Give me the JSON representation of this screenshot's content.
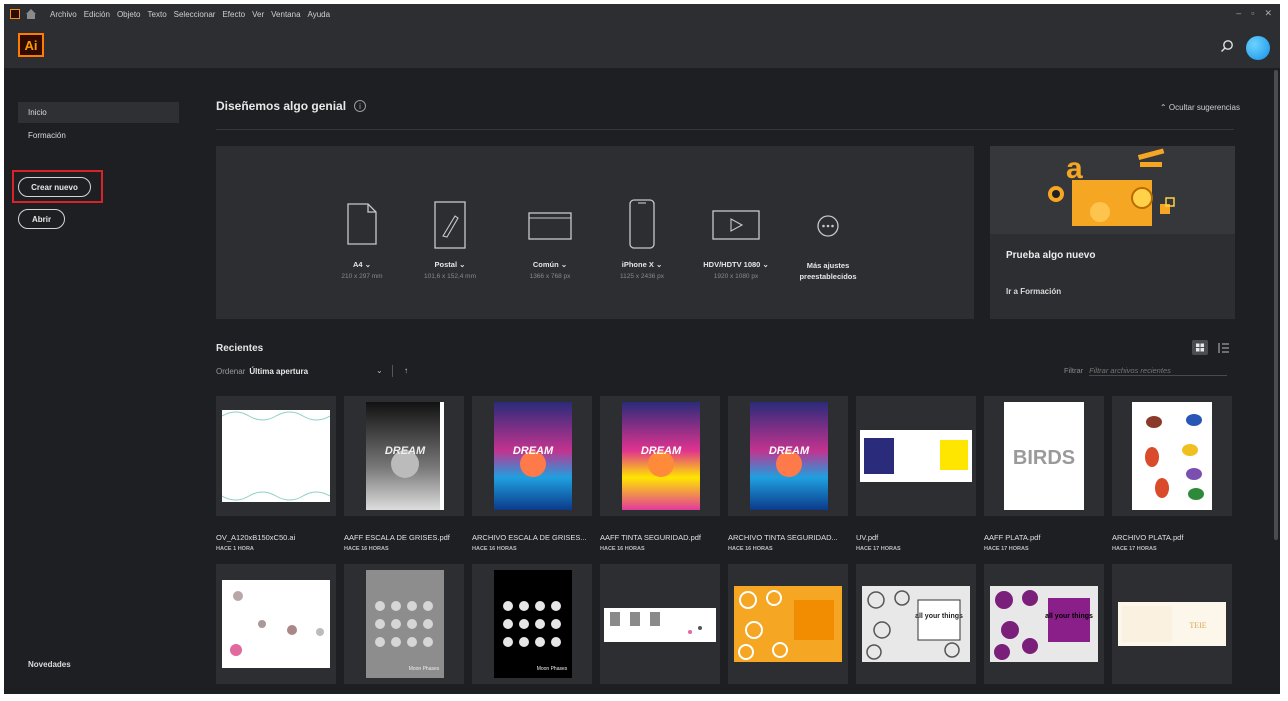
{
  "menubar": {
    "items": [
      "Archivo",
      "Edición",
      "Objeto",
      "Texto",
      "Seleccionar",
      "Efecto",
      "Ver",
      "Ventana",
      "Ayuda"
    ],
    "window_controls": [
      "–",
      "▫",
      "✕"
    ]
  },
  "appbar": {
    "logo": "Ai"
  },
  "sidebar": {
    "items": [
      {
        "label": "Inicio",
        "active": true
      },
      {
        "label": "Formación",
        "active": false
      }
    ],
    "create_new": "Crear nuevo",
    "open": "Abrir",
    "news": "Novedades"
  },
  "main": {
    "heading": "Diseñemos algo genial",
    "hide_suggestions": "Ocultar sugerencias",
    "presets": [
      {
        "label": "A4",
        "sub": "210 x 297 mm",
        "icon": "document-icon"
      },
      {
        "label": "Postal",
        "sub": "101,6 x 152,4 mm",
        "icon": "brush-document-icon"
      },
      {
        "label": "Común",
        "sub": "1366 x 768 px",
        "icon": "web-icon"
      },
      {
        "label": "iPhone X",
        "sub": "1125 x 2436 px",
        "icon": "phone-icon"
      },
      {
        "label": "HDV/HDTV 1080",
        "sub": "1920 x 1080 px",
        "icon": "video-icon"
      },
      {
        "label": "Más ajustes preestablecidos",
        "sub": "",
        "icon": "more-icon"
      }
    ],
    "promo": {
      "title": "Prueba algo nuevo",
      "link": "Ir a Formación"
    },
    "recent": {
      "title": "Recientes",
      "sort_label": "Ordenar",
      "sort_value": "Última apertura",
      "filter_label": "Filtrar",
      "filter_placeholder": "Filtrar archivos recientes",
      "files": [
        {
          "name": "OV_A120xB150xC50.ai",
          "date": "HACE 1 HORA"
        },
        {
          "name": "AAFF ESCALA DE GRISES.pdf",
          "date": "HACE 16 HORAS"
        },
        {
          "name": "ARCHIVO ESCALA DE GRISES...",
          "date": "HACE 16 HORAS"
        },
        {
          "name": "AAFF TINTA SEGURIDAD.pdf",
          "date": "HACE 16 HORAS"
        },
        {
          "name": "ARCHIVO TINTA SEGURIDAD...",
          "date": "HACE 16 HORAS"
        },
        {
          "name": "UV.pdf",
          "date": "HACE 17 HORAS"
        },
        {
          "name": "AAFF PLATA.pdf",
          "date": "HACE 17 HORAS"
        },
        {
          "name": "ARCHIVO PLATA.pdf",
          "date": "HACE 17 HORAS"
        }
      ],
      "second_row_count": 8,
      "thumb_texts": [
        "DREAM",
        "BIRDS",
        "all your things",
        "Moon Phases",
        "TEIE"
      ]
    }
  },
  "colors": {
    "window_bg": "#1d1f22",
    "panel_bg": "#2c2e31",
    "accent_orange": "#ff7c00",
    "highlight_red": "#d9232a",
    "avatar_blue": "#1590e6"
  }
}
